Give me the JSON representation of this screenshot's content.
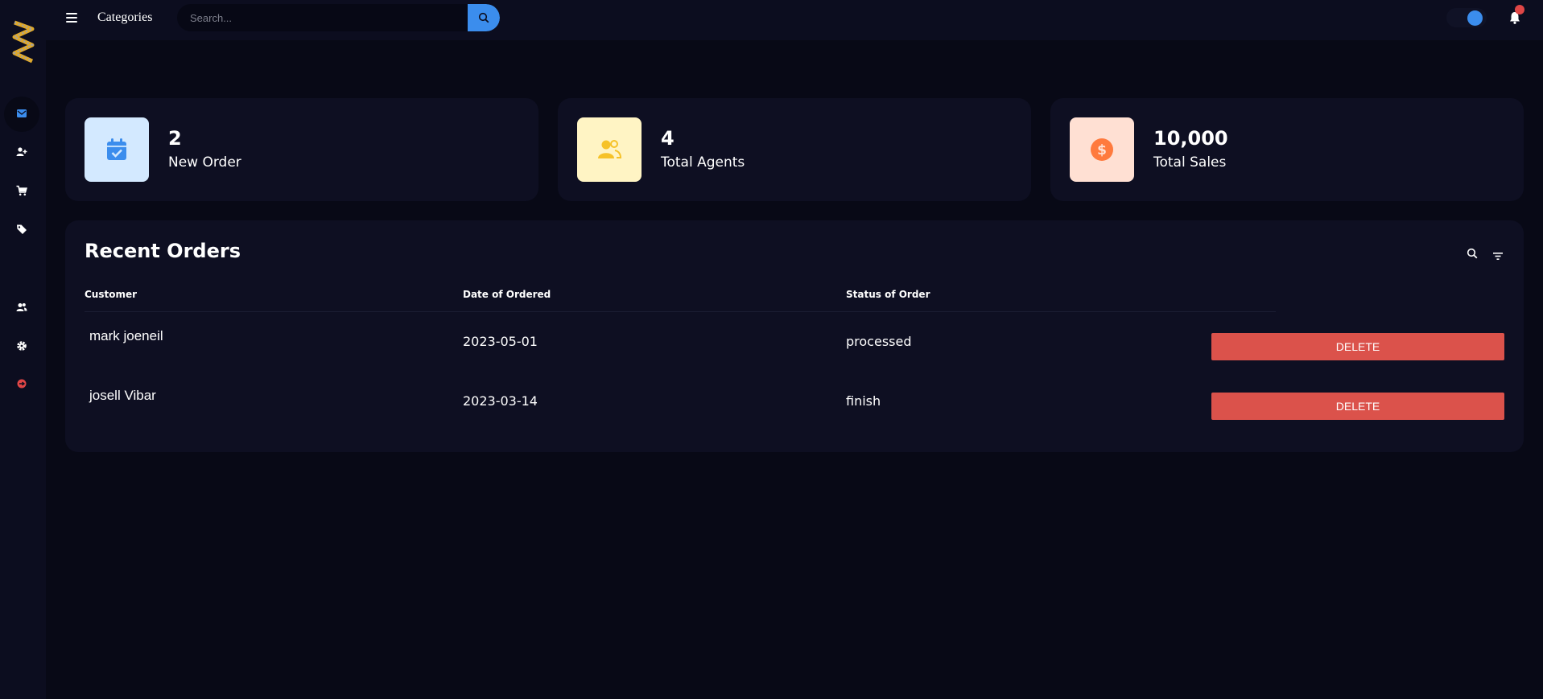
{
  "header": {
    "title": "Categories",
    "search_placeholder": "Search...",
    "search_value": ""
  },
  "sidebar": {
    "items": [
      {
        "icon": "mail-icon",
        "active": true
      },
      {
        "icon": "add-user-icon",
        "active": false
      },
      {
        "icon": "cart-icon",
        "active": false
      },
      {
        "icon": "tag-icon",
        "active": false
      },
      {
        "icon": "users-icon",
        "active": false
      },
      {
        "icon": "gear-icon",
        "active": false
      },
      {
        "icon": "logout-icon",
        "active": false
      }
    ]
  },
  "stats": [
    {
      "value": "2",
      "label": "New Order",
      "icon": "calendar-check-icon",
      "icon_bg": "#d3e9ff",
      "icon_color": "#3b8ded"
    },
    {
      "value": "4",
      "label": "Total Agents",
      "icon": "users-icon",
      "icon_bg": "#fff4c4",
      "icon_color": "#f6c228"
    },
    {
      "value": "10,000",
      "label": "Total Sales",
      "icon": "dollar-icon",
      "icon_bg": "#ffe0d3",
      "icon_color": "#ff7a3d"
    }
  ],
  "orders": {
    "title": "Recent Orders",
    "columns": [
      "Customer",
      "Date of Ordered",
      "Status of Order"
    ],
    "rows": [
      {
        "customer": "mark joeneil",
        "date": "2023-05-01",
        "status": "processed",
        "action": "DELETE"
      },
      {
        "customer": "josell Vibar",
        "date": "2023-03-14",
        "status": "finish",
        "action": "DELETE"
      }
    ]
  },
  "colors": {
    "background": "#080916",
    "panel": "#0e0f22",
    "accent": "#3b8ded",
    "danger": "#db524b"
  }
}
